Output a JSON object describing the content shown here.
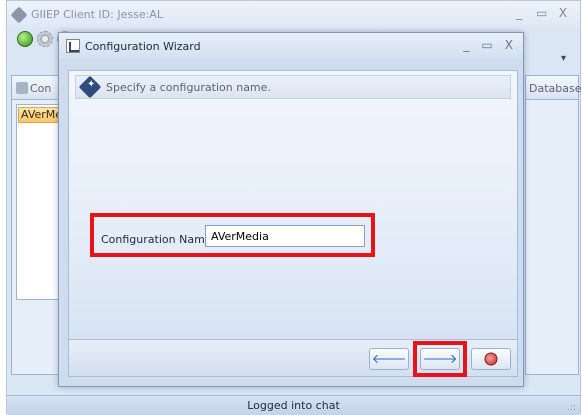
{
  "main_window": {
    "title": "GIIEP Client ID: Jesse:AL",
    "controls": [
      "_",
      "▭",
      "X"
    ],
    "ribbon_dropdown": "▾",
    "left_pane": {
      "tab_label": "Con",
      "list_items": [
        "AVerMedia"
      ]
    },
    "right_pane": {
      "tab_label": "Database"
    },
    "status_text": "Logged into chat",
    "grip": ".::"
  },
  "dialog": {
    "title": "Configuration Wizard",
    "controls": [
      "_",
      "▭",
      "X"
    ],
    "header_text": "Specify a configuration name.",
    "config_name_label": "Configuration Name",
    "config_name_value": "AVerMedia",
    "buttons": {
      "back_symbol": "🡐",
      "next_symbol": "🡒"
    }
  },
  "colors": {
    "highlight": "#e8121b",
    "accent_blue": "#2b69c6",
    "selected_item": "#f7c56a"
  }
}
